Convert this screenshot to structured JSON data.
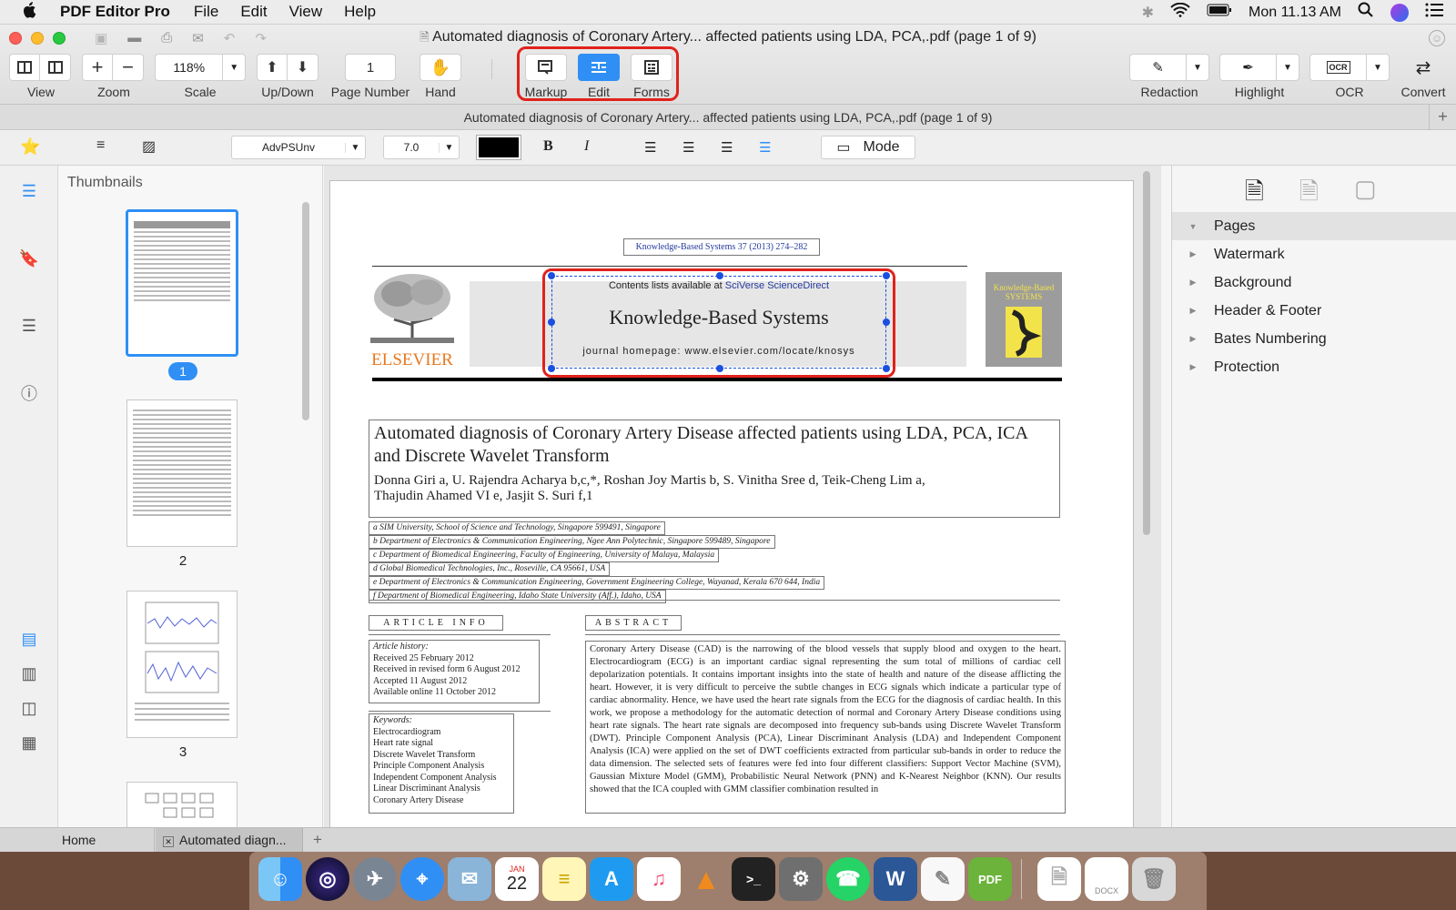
{
  "menubar": {
    "apple": "",
    "app_name": "PDF Editor Pro",
    "items": [
      "File",
      "Edit",
      "View",
      "Help"
    ],
    "clock": "Mon 11.13 AM"
  },
  "window": {
    "title": "Automated diagnosis of Coronary Artery... affected patients using LDA, PCA,.pdf (page 1 of 9)",
    "toolbar": {
      "view_label": "View",
      "zoom_label": "Zoom",
      "zoom_in": "+",
      "zoom_out": "−",
      "scale_value": "118%",
      "scale_label": "Scale",
      "updown_label": "Up/Down",
      "page_number_value": "1",
      "page_number_label": "Page Number",
      "hand_label": "Hand",
      "markup_label": "Markup",
      "edit_label": "Edit",
      "forms_label": "Forms",
      "redaction_label": "Redaction",
      "highlight_label": "Highlight",
      "ocr_label": "OCR",
      "ocr_icon_text": "OCR",
      "convert_label": "Convert"
    },
    "tab_title": "Automated diagnosis of Coronary Artery... affected patients using LDA, PCA,.pdf (page 1 of 9)",
    "format_bar": {
      "font": "AdvPSUnv",
      "size": "7.0",
      "bold": "B",
      "italic": "I",
      "mode_label": "Mode"
    }
  },
  "thumbnails": {
    "header": "Thumbnails",
    "pages": [
      "1",
      "2",
      "3"
    ]
  },
  "document": {
    "journal_ref": "Knowledge-Based Systems 37 (2013) 274–282",
    "contents_prefix": "Contents lists available at ",
    "contents_link": "SciVerse ScienceDirect",
    "journal_name": "Knowledge-Based Systems",
    "homepage": "journal homepage: www.elsevier.com/locate/knosys",
    "publisher": "ELSEVIER",
    "cover_text": "Knowledge-Based SYSTEMS",
    "title": "Automated diagnosis of Coronary Artery Disease affected patients using LDA, PCA, ICA and Discrete Wavelet Transform",
    "authors_line1": "Donna Giri a, U. Rajendra Acharya b,c,*, Roshan Joy Martis b, S. Vinitha Sree d, Teik-Cheng Lim a,",
    "authors_line2": "Thajudin Ahamed VI e, Jasjit S. Suri f,1",
    "affiliations": [
      "a SIM University, School of Science and Technology, Singapore 599491, Singapore",
      "b Department of Electronics & Communication Engineering, Ngee Ann Polytechnic, Singapore 599489, Singapore",
      "c Department of Biomedical Engineering, Faculty of Engineering, University of Malaya, Malaysia",
      "d Global Biomedical Technologies, Inc., Roseville, CA 95661, USA",
      "e Department of Electronics & Communication Engineering, Government Engineering College, Wayanad, Kerala 670 644, India",
      "f Department of Biomedical Engineering, Idaho State University (Aff.), Idaho, USA"
    ],
    "article_info_heading": "ARTICLE INFO",
    "abstract_heading": "ABSTRACT",
    "history_label": "Article history:",
    "history": [
      "Received 25 February 2012",
      "Received in revised form 6 August 2012",
      "Accepted 11 August 2012",
      "Available online 11 October 2012"
    ],
    "keywords_label": "Keywords:",
    "keywords": [
      "Electrocardiogram",
      "Heart rate signal",
      "Discrete Wavelet Transform",
      "Principle Component Analysis",
      "Independent Component Analysis",
      "Linear Discriminant Analysis",
      "Coronary Artery Disease"
    ],
    "abstract": "Coronary Artery Disease (CAD) is the narrowing of the blood vessels that supply blood and oxygen to the heart. Electrocardiogram (ECG) is an important cardiac signal representing the sum total of millions of cardiac cell depolarization potentials. It contains important insights into the state of health and nature of the disease afflicting the heart. However, it is very difficult to perceive the subtle changes in ECG signals which indicate a particular type of cardiac abnormality. Hence, we have used the heart rate signals from the ECG for the diagnosis of cardiac health. In this work, we propose a methodology for the automatic detection of normal and Coronary Artery Disease conditions using heart rate signals. The heart rate signals are decomposed into frequency sub-bands using Discrete Wavelet Transform (DWT). Principle Component Analysis (PCA), Linear Discriminant Analysis (LDA) and Independent Component Analysis (ICA) were applied on the set of DWT coefficients extracted from particular sub-bands in order to reduce the data dimension. The selected sets of features were fed into four different classifiers: Support Vector Machine (SVM), Gaussian Mixture Model (GMM), Probabilistic Neural Network (PNN) and K-Nearest Neighbor (KNN). Our results showed that the ICA coupled with GMM classifier combination resulted in"
  },
  "right_panel": {
    "items": [
      "Pages",
      "Watermark",
      "Background",
      "Header & Footer",
      "Bates Numbering",
      "Protection"
    ]
  },
  "bottom_tabs": {
    "home": "Home",
    "doc_tab": "Automated diagn...",
    "add": "+"
  },
  "dock": {
    "calendar_month": "JAN",
    "calendar_day": "22",
    "terminal_prompt": ">_",
    "pdf_badge": "PDF",
    "word_letter": "W",
    "docx_label": "DOCX"
  },
  "colors": {
    "accent": "#2f8ff5",
    "highlight_outline": "#e0221b",
    "selection_handles": "#1a4fe0",
    "elsevier_orange": "#e8781e"
  }
}
